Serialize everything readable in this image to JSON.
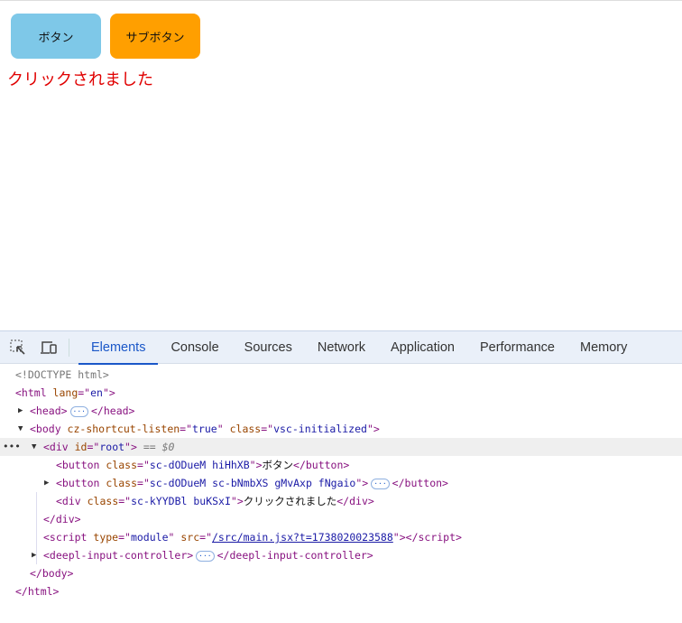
{
  "page": {
    "button_label": "ボタン",
    "sub_button_label": "サブボタン",
    "message": "クリックされました",
    "colors": {
      "button": "#7ec8e8",
      "sub_button": "#ff9f00",
      "message": "#e00000"
    }
  },
  "devtools": {
    "tabs": [
      "Elements",
      "Console",
      "Sources",
      "Network",
      "Application",
      "Performance",
      "Memory"
    ],
    "active_tab": "Elements",
    "lines": [
      {
        "indent": 17,
        "tokens": [
          [
            "dt",
            "<!DOCTYPE html>"
          ]
        ]
      },
      {
        "indent": 17,
        "tokens": [
          [
            "tag",
            "<html "
          ],
          [
            "an",
            "lang"
          ],
          [
            "tag",
            "=\""
          ],
          [
            "av",
            "en"
          ],
          [
            "tag",
            "\">"
          ]
        ]
      },
      {
        "indent": 33,
        "arrow": "right",
        "tokens": [
          [
            "tag",
            "<head>"
          ],
          [
            "ell",
            "···"
          ],
          [
            "tag",
            "</head>"
          ]
        ]
      },
      {
        "indent": 33,
        "arrow": "down",
        "tokens": [
          [
            "tag",
            "<body "
          ],
          [
            "an",
            "cz-shortcut-listen"
          ],
          [
            "tag",
            "=\""
          ],
          [
            "av",
            "true"
          ],
          [
            "tag",
            "\" "
          ],
          [
            "an",
            "class"
          ],
          [
            "tag",
            "=\""
          ],
          [
            "av",
            "vsc-initialized"
          ],
          [
            "tag",
            "\">"
          ]
        ]
      },
      {
        "indent": 48,
        "arrow": "down",
        "selected": true,
        "tokens": [
          [
            "tag",
            "<div "
          ],
          [
            "an",
            "id"
          ],
          [
            "tag",
            "=\""
          ],
          [
            "av",
            "root"
          ],
          [
            "tag",
            "\">"
          ],
          [
            "cm",
            " == $0"
          ]
        ]
      },
      {
        "indent": 62,
        "tokens": [
          [
            "tag",
            "<button "
          ],
          [
            "an",
            "class"
          ],
          [
            "tag",
            "=\""
          ],
          [
            "av",
            "sc-dODueM hiHhXB"
          ],
          [
            "tag",
            "\">"
          ],
          [
            "tx",
            "ボタン"
          ],
          [
            "tag",
            "</button>"
          ]
        ]
      },
      {
        "indent": 62,
        "arrow": "right",
        "tokens": [
          [
            "tag",
            "<button "
          ],
          [
            "an",
            "class"
          ],
          [
            "tag",
            "=\""
          ],
          [
            "av",
            "sc-dODueM sc-bNmbXS gMvAxp fNgaio"
          ],
          [
            "tag",
            "\">"
          ],
          [
            "ell",
            "···"
          ],
          [
            "tag",
            "</button>"
          ]
        ]
      },
      {
        "indent": 62,
        "tokens": [
          [
            "tag",
            "<div "
          ],
          [
            "an",
            "class"
          ],
          [
            "tag",
            "=\""
          ],
          [
            "av",
            "sc-kYYDBl buKSxI"
          ],
          [
            "tag",
            "\">"
          ],
          [
            "tx",
            "クリックされました"
          ],
          [
            "tag",
            "</div>"
          ]
        ]
      },
      {
        "indent": 48,
        "tokens": [
          [
            "tag",
            "</div>"
          ]
        ]
      },
      {
        "indent": 48,
        "tokens": [
          [
            "tag",
            "<script "
          ],
          [
            "an",
            "type"
          ],
          [
            "tag",
            "=\""
          ],
          [
            "av",
            "module"
          ],
          [
            "tag",
            "\" "
          ],
          [
            "an",
            "src"
          ],
          [
            "tag",
            "=\""
          ],
          [
            "lnk",
            "/src/main.jsx?t=1738020023588"
          ],
          [
            "tag",
            "\"></script>"
          ]
        ]
      },
      {
        "indent": 48,
        "arrow": "right",
        "tokens": [
          [
            "tag",
            "<deepl-input-controller>"
          ],
          [
            "ell",
            "···"
          ],
          [
            "tag",
            "</deepl-input-controller>"
          ]
        ]
      },
      {
        "indent": 33,
        "tokens": [
          [
            "tag",
            "</body>"
          ]
        ]
      },
      {
        "indent": 17,
        "tokens": [
          [
            "tag",
            "</html>"
          ]
        ]
      }
    ]
  }
}
